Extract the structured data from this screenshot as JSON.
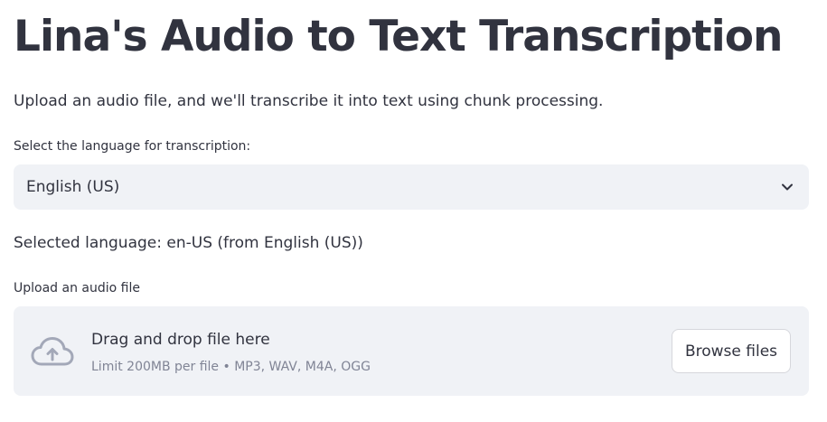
{
  "header": {
    "title": "Lina's Audio to Text Transcription"
  },
  "intro": "Upload an audio file, and we'll transcribe it into text using chunk processing.",
  "language_select": {
    "label": "Select the language for transcription:",
    "value": "English (US)",
    "icon": "chevron-down-icon"
  },
  "selected_language_text": "Selected language: en-US (from English (US))",
  "uploader": {
    "label": "Upload an audio file",
    "drop_title": "Drag and drop file here",
    "drop_limit": "Limit 200MB per file • MP3, WAV, M4A, OGG",
    "browse_label": "Browse files",
    "icon": "cloud-upload-icon"
  },
  "colors": {
    "text": "#31333f",
    "muted_text": "#808495",
    "widget_background": "#f0f2f6",
    "icon": "#a3a8b8"
  }
}
